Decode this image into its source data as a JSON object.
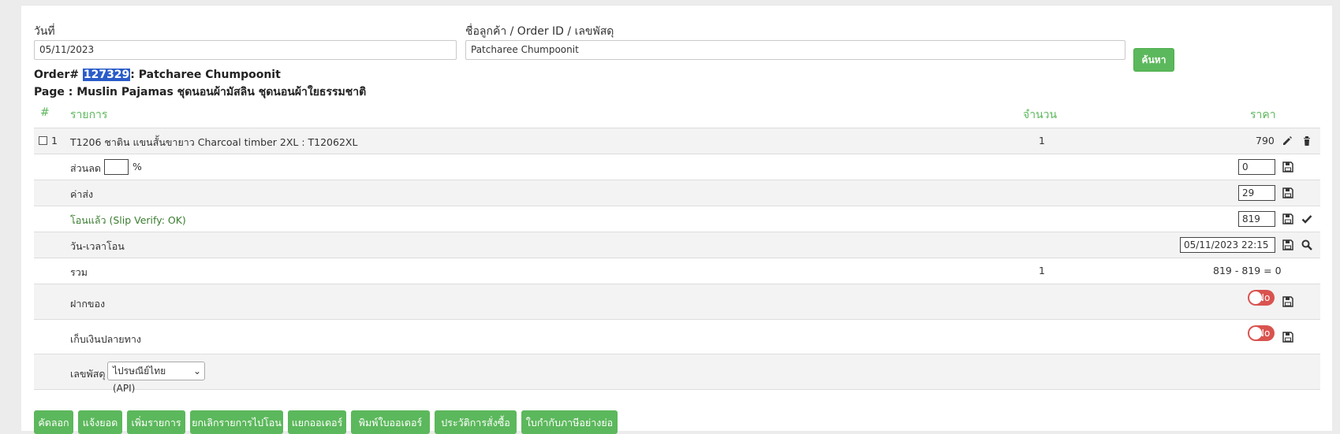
{
  "search": {
    "date_label": "วันที่",
    "date_value": "05/11/2023",
    "customer_label": "ชื่อลูกค้า / Order ID / เลขพัสดุ",
    "customer_value": "Patcharee Chumpoonit",
    "search_button": "ค้นหา"
  },
  "order": {
    "prefix": "Order#",
    "id": "127329",
    "customer": ": Patcharee Chumpoonit",
    "page": "Page : Muslin Pajamas ชุดนอนผ้ามัสลิน ชุดนอนผ้าใยธรรมชาติ"
  },
  "table": {
    "col_no": "#",
    "col_item": "รายการ",
    "col_qty": "จำนวน",
    "col_price": "ราคา"
  },
  "item": {
    "no": "1",
    "name": "T1206 ชาติน แขนสั้นขายาว Charcoal timber 2XL : T12062XL",
    "qty": "1",
    "price": "790"
  },
  "discount": {
    "label": "ส่วนลด",
    "unit": "%",
    "value": "0"
  },
  "shipping": {
    "label": "ค่าส่ง",
    "value": "29"
  },
  "paid": {
    "label": "โอนแล้ว (Slip Verify: OK)",
    "value": "819"
  },
  "transfer_time": {
    "label": "วัน-เวลาโอน",
    "value": "05/11/2023 22:15"
  },
  "total": {
    "label": "รวม",
    "qty": "1",
    "value": "819 - 819 = 0"
  },
  "deposit": {
    "label": "ฝากของ",
    "toggle": "No"
  },
  "cod": {
    "label": "เก็บเงินปลายทาง",
    "toggle": "No"
  },
  "tracking": {
    "label": "เลขพัสดุ",
    "carrier": "ไปรษณีย์ไทย (API)"
  },
  "bottom_buttons": [
    "คัดลอก",
    "แจ้งยอด",
    "เพิ่มรายการ",
    "ยกเลิกรายการไปโอน",
    "แยกออเดอร์",
    "พิมพ์ใบออเดอร์",
    "ประวัติการสั่งซื้อ",
    "ใบกำกับภาษีอย่างย่อ"
  ],
  "colors": {
    "accent": "#5cb85c",
    "danger": "#d9534f",
    "highlight": "#2a5cc9"
  }
}
